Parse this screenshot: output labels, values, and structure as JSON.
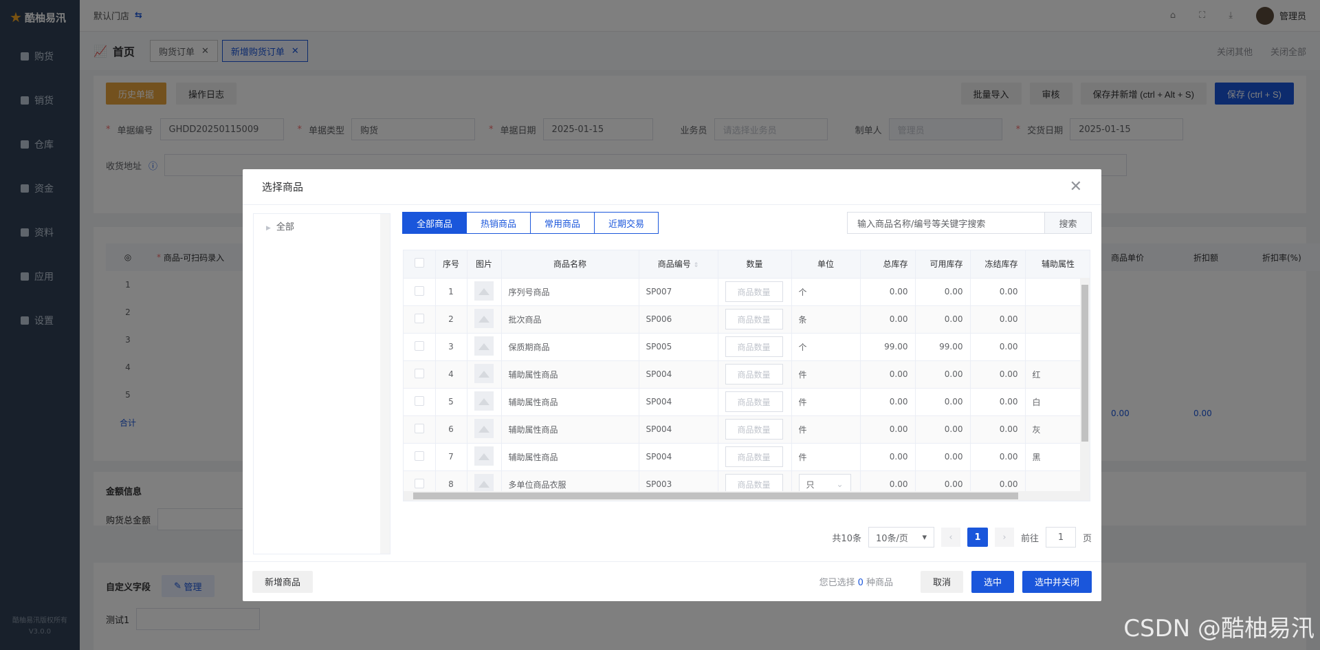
{
  "app": {
    "logo_text": "酷柚易汛",
    "copyright": "酷柚易汛版权所有",
    "version": "V3.0.0"
  },
  "sidebar": {
    "items": [
      {
        "label": "购货",
        "icon": "cart-icon"
      },
      {
        "label": "销货",
        "icon": "sell-icon"
      },
      {
        "label": "仓库",
        "icon": "warehouse-icon"
      },
      {
        "label": "资金",
        "icon": "grid-icon"
      },
      {
        "label": "资料",
        "icon": "data-icon"
      },
      {
        "label": "应用",
        "icon": "apps-icon"
      },
      {
        "label": "设置",
        "icon": "gear-icon"
      }
    ]
  },
  "topbar": {
    "store": "默认门店",
    "user": "管理员"
  },
  "tabs": {
    "home": "首页",
    "items": [
      "购货订单",
      "新增购货订单"
    ],
    "close_others": "关闭其他",
    "close_all": "关闭全部"
  },
  "toolbar": {
    "history": "历史单据",
    "log": "操作日志",
    "import": "批量导入",
    "audit": "审核",
    "save_new": "保存并新增 (ctrl + Alt + S)",
    "save": "保存 (ctrl + S)"
  },
  "form": {
    "doc_no_label": "单据编号",
    "doc_no": "GHDD20250115009",
    "type_label": "单据类型",
    "type": "购货",
    "date_label": "单据日期",
    "date": "2025-01-15",
    "clerk_label": "业务员",
    "clerk_placeholder": "请选择业务员",
    "maker_label": "制单人",
    "maker": "管理员",
    "deliver_label": "交货日期",
    "deliver": "2025-01-15",
    "address_label": "收货地址"
  },
  "bg_table": {
    "col_goods": "商品-可扫码录入",
    "rows": [
      "1",
      "2",
      "3",
      "4",
      "5"
    ],
    "total": "合计",
    "col_price": "商品单价",
    "col_discount": "折扣额",
    "col_rate": "折扣率(%)",
    "price_total": "0.00",
    "discount_total": "0.00"
  },
  "amount": {
    "title": "金额信息",
    "total_label": "购货总金额"
  },
  "custom": {
    "title": "自定义字段",
    "manage": "管理",
    "test_label": "测试1"
  },
  "dialog": {
    "title": "选择商品",
    "tree_root": "全部",
    "filters": [
      "全部商品",
      "热销商品",
      "常用商品",
      "近期交易"
    ],
    "search_placeholder": "输入商品名称/编号等关键字搜索",
    "search_btn": "搜索",
    "columns": [
      "序号",
      "图片",
      "商品名称",
      "商品编号",
      "数量",
      "单位",
      "总库存",
      "可用库存",
      "冻结库存",
      "辅助属性"
    ],
    "qty_placeholder": "商品数量",
    "rows": [
      {
        "no": "1",
        "name": "序列号商品",
        "code": "SP007",
        "unit": "个",
        "total": "0.00",
        "avail": "0.00",
        "frozen": "0.00",
        "attr": ""
      },
      {
        "no": "2",
        "name": "批次商品",
        "code": "SP006",
        "unit": "条",
        "total": "0.00",
        "avail": "0.00",
        "frozen": "0.00",
        "attr": ""
      },
      {
        "no": "3",
        "name": "保质期商品",
        "code": "SP005",
        "unit": "个",
        "total": "99.00",
        "avail": "99.00",
        "frozen": "0.00",
        "attr": ""
      },
      {
        "no": "4",
        "name": "辅助属性商品",
        "code": "SP004",
        "unit": "件",
        "total": "0.00",
        "avail": "0.00",
        "frozen": "0.00",
        "attr": "红"
      },
      {
        "no": "5",
        "name": "辅助属性商品",
        "code": "SP004",
        "unit": "件",
        "total": "0.00",
        "avail": "0.00",
        "frozen": "0.00",
        "attr": "白"
      },
      {
        "no": "6",
        "name": "辅助属性商品",
        "code": "SP004",
        "unit": "件",
        "total": "0.00",
        "avail": "0.00",
        "frozen": "0.00",
        "attr": "灰"
      },
      {
        "no": "7",
        "name": "辅助属性商品",
        "code": "SP004",
        "unit": "件",
        "total": "0.00",
        "avail": "0.00",
        "frozen": "0.00",
        "attr": "黑"
      },
      {
        "no": "8",
        "name": "多单位商品衣服",
        "code": "SP003",
        "unit": "只",
        "total": "0.00",
        "avail": "0.00",
        "frozen": "0.00",
        "attr": ""
      }
    ],
    "pager": {
      "total": "共10条",
      "size": "10条/页",
      "page": "1",
      "goto": "前往",
      "goto_val": "1",
      "suffix": "页"
    },
    "add_goods": "新增商品",
    "selected_prefix": "您已选择",
    "selected_count": "0",
    "selected_suffix": "种商品",
    "cancel": "取消",
    "select": "选中",
    "select_close": "选中并关闭"
  },
  "watermark": "CSDN @酷柚易汛"
}
